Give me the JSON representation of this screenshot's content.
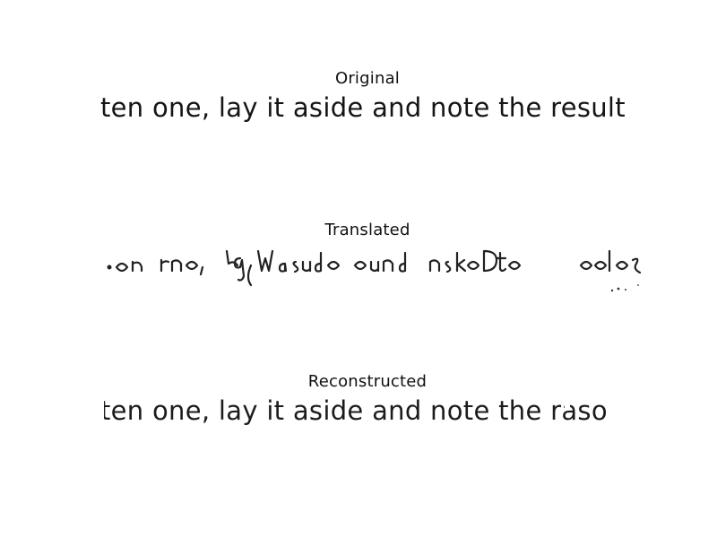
{
  "panels": [
    {
      "title": "Original",
      "text": "ten one, lay it aside and note the result"
    },
    {
      "title": "Translated",
      "handwriting_description_hidden": ""
    },
    {
      "title": "Reconstructed",
      "text": "ten one, lay it aside and note the raso"
    }
  ]
}
